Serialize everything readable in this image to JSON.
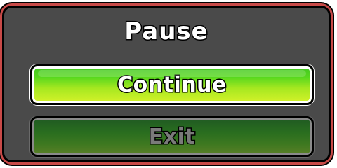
{
  "pause_menu": {
    "title": "Pause",
    "continue_label": "Continue",
    "exit_label": "Exit"
  },
  "colors": {
    "panel": "#4a4a4a",
    "border_accent": "#c84a48",
    "continue_green": "#58d81e",
    "exit_green_dim": "#2a6e1f"
  }
}
